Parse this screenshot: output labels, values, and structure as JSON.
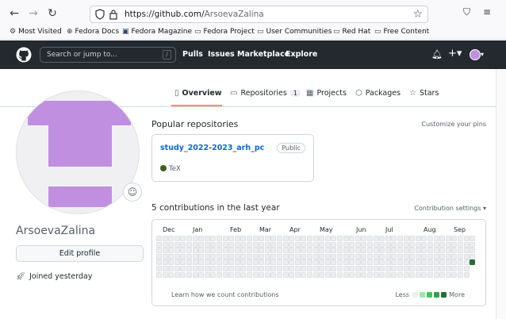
{
  "browser": {
    "url_host": "https://github.com/",
    "url_path": "ArsoevaZalina",
    "bookmarks": [
      {
        "label": "Most Visited",
        "icon": "gear-icon"
      },
      {
        "label": "Fedora Docs",
        "icon": "globe-icon"
      },
      {
        "label": "Fedora Magazine",
        "icon": "fedora-icon"
      },
      {
        "label": "Fedora Project",
        "icon": "folder-icon"
      },
      {
        "label": "User Communities",
        "icon": "folder-icon"
      },
      {
        "label": "Red Hat",
        "icon": "folder-icon"
      },
      {
        "label": "Free Content",
        "icon": "folder-icon"
      }
    ]
  },
  "github": {
    "search_placeholder": "Search or jump to...",
    "search_key": "/",
    "nav": [
      "Pulls",
      "Issues",
      "Marketplace",
      "Explore"
    ]
  },
  "tabs": [
    {
      "label": "Overview",
      "icon": "book-icon"
    },
    {
      "label": "Repositories",
      "icon": "repo-icon",
      "count": "1"
    },
    {
      "label": "Projects",
      "icon": "table-icon"
    },
    {
      "label": "Packages",
      "icon": "package-icon"
    },
    {
      "label": "Stars",
      "icon": "star-icon"
    }
  ],
  "profile": {
    "username": "ArsoevaZalina",
    "edit_label": "Edit profile",
    "joined": "Joined yesterday",
    "avatar_color": "#c18fe0"
  },
  "popular": {
    "title": "Popular repositories",
    "customize": "Customize your pins",
    "repo": {
      "name": "study_2022-2023_arh_pc",
      "visibility": "Public",
      "language": "TeX",
      "language_color": "#3d6117"
    }
  },
  "contributions": {
    "title": "5 contributions in the last year",
    "settings": "Contribution settings",
    "months": [
      "Dec",
      "Jan",
      "Feb",
      "Mar",
      "Apr",
      "May",
      "Jun",
      "Jul",
      "Aug",
      "Sep"
    ],
    "learn": "Learn how we count contributions",
    "less": "Less",
    "more": "More",
    "legend_colors": [
      "#ebedf0",
      "#9be9a8",
      "#40c463",
      "#30a14e",
      "#216e39"
    ],
    "active_level_color": "#216e39"
  }
}
